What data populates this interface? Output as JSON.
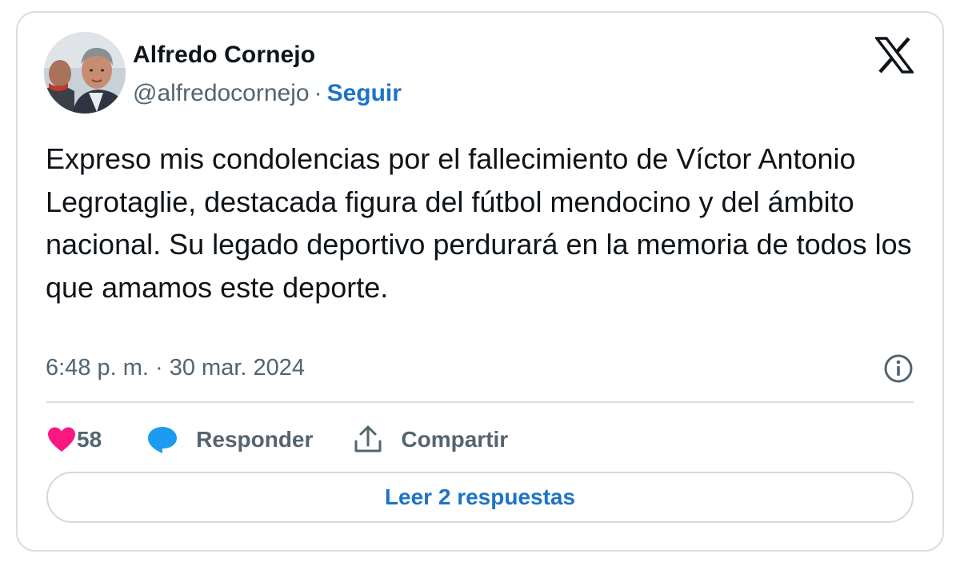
{
  "author": {
    "name": "Alfredo Cornejo",
    "handle": "@alfredocornejo",
    "separator": "·",
    "follow_label": "Seguir"
  },
  "tweet": {
    "text": "Expreso mis condolencias por el fallecimiento de Víctor Antonio Legrotaglie, destacada figura del fútbol mendocino y del ámbito nacional. Su legado deportivo perdurará en la memoria de todos los que amamos este deporte.",
    "timestamp": "6:48 p. m. · 30 mar. 2024"
  },
  "actions": {
    "like_count": "58",
    "reply_label": "Responder",
    "share_label": "Compartir"
  },
  "replies_button": "Leer 2 respuestas",
  "icons": {
    "logo": "x-logo-icon",
    "info": "info-icon",
    "like": "heart-icon",
    "reply": "speech-bubble-icon",
    "share": "share-upload-icon"
  },
  "colors": {
    "link_blue": "#1d74c6",
    "heart_pink": "#f91880",
    "reply_blue": "#1d9bf0",
    "secondary_text": "#536471",
    "border": "#d8dee2"
  }
}
